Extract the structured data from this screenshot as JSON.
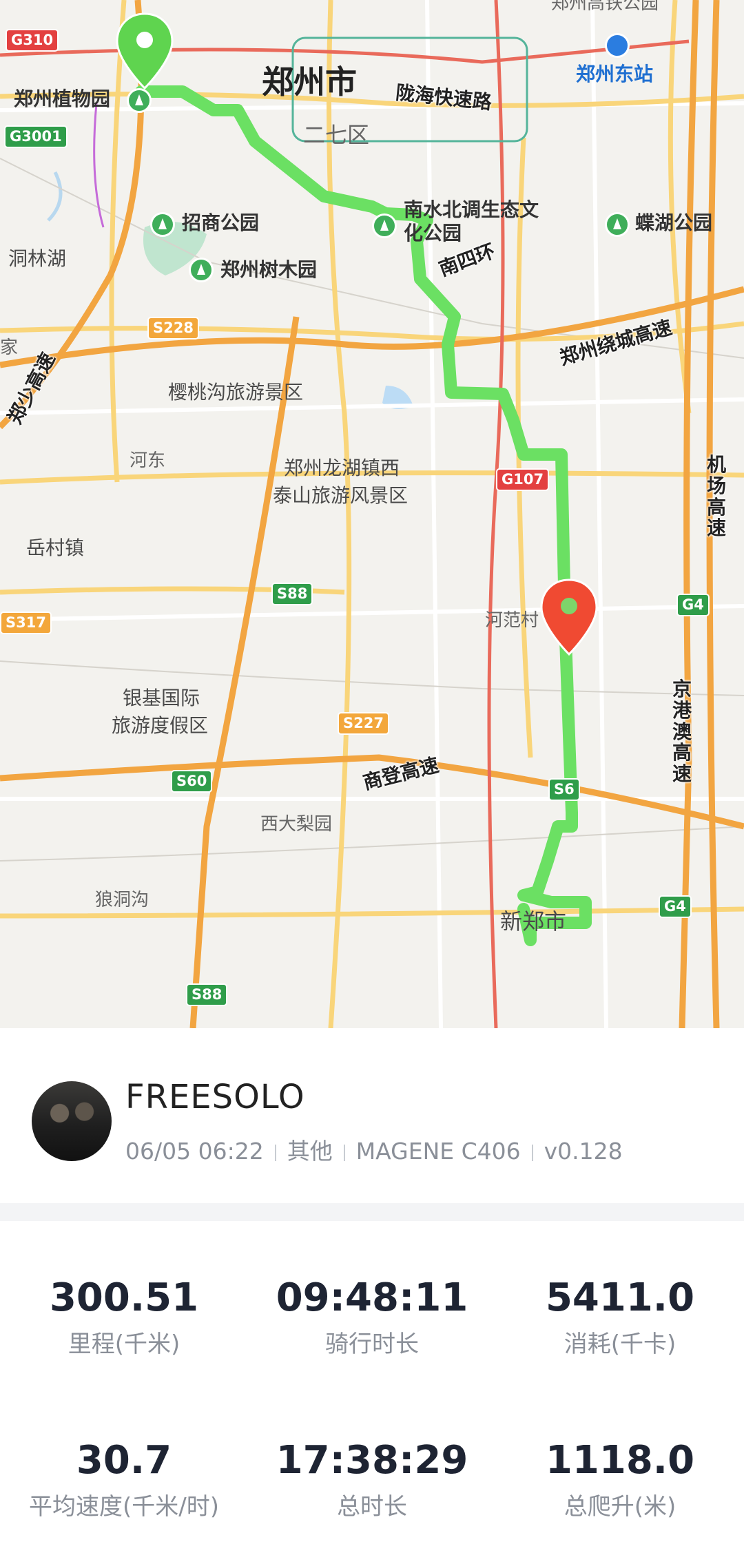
{
  "map": {
    "city": "郑州市",
    "district": "二七区",
    "station": "郑州东站",
    "station_top": "郑州高铁公园",
    "roads": [
      "陇海快速路",
      "南四环",
      "郑州绕城高速",
      "郑少高速",
      "商登高速",
      "机场高速",
      "京港澳高速"
    ],
    "places": [
      "郑州植物园",
      "招商公园",
      "郑州树木园",
      "南水北调生态文化公园",
      "蝶湖公园",
      "洞林湖",
      "樱桃沟旅游景区",
      "河东",
      "郑州龙湖镇西",
      "泰山旅游风景区",
      "岳村镇",
      "河范村",
      "银基国际",
      "旅游度假区",
      "西大梨园",
      "狼洞沟",
      "新郑市",
      "家"
    ],
    "shields": [
      "G310",
      "G3001",
      "S228",
      "G107",
      "S88",
      "S317",
      "S227",
      "S60",
      "G4",
      "S6"
    ],
    "start_icon": "start-pin-icon",
    "end_icon": "end-pin-icon",
    "route_color": "#6be063"
  },
  "profile": {
    "username": "FREESOLO",
    "date": "06/05 06:22",
    "type": "其他",
    "device": "MAGENE C406",
    "version": "v0.128"
  },
  "stats": [
    {
      "value": "300.51",
      "label": "里程(千米)"
    },
    {
      "value": "09:48:11",
      "label": "骑行时长"
    },
    {
      "value": "5411.0",
      "label": "消耗(千卡)"
    },
    {
      "value": "30.7",
      "label": "平均速度(千米/时)"
    },
    {
      "value": "17:38:29",
      "label": "总时长"
    },
    {
      "value": "1118.0",
      "label": "总爬升(米)"
    }
  ]
}
